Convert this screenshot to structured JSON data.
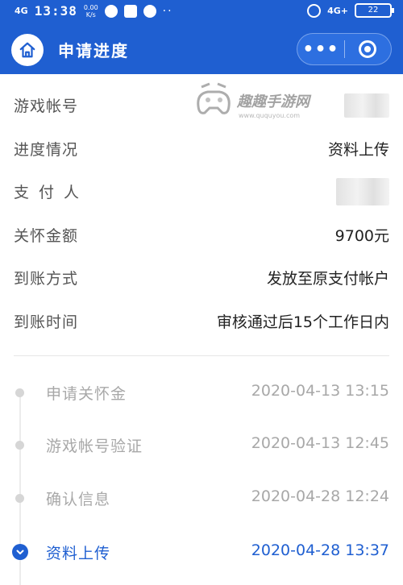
{
  "status_bar": {
    "network_left": "4G",
    "time": "13:38",
    "speed_value": "0.00",
    "speed_unit": "K/s",
    "dots": "··",
    "network_right": "4G+",
    "battery": "22"
  },
  "header": {
    "title": "申请进度",
    "more_label": "•••"
  },
  "info": {
    "rows": [
      {
        "label": "游戏帐号",
        "value": ""
      },
      {
        "label": "进度情况",
        "value": "资料上传"
      },
      {
        "label": "支付人",
        "value": ""
      },
      {
        "label": "关怀金额",
        "value": "9700元"
      },
      {
        "label": "到账方式",
        "value": "发放至原支付帐户"
      },
      {
        "label": "到账时间",
        "value": "审核通过后15个工作日内"
      }
    ]
  },
  "watermark": {
    "brand": "趣趣手游网",
    "url": "www.ququyou.com"
  },
  "timeline": {
    "steps": [
      {
        "name": "申请关怀金",
        "time": "2020-04-13 13:15",
        "active": false
      },
      {
        "name": "游戏帐号验证",
        "time": "2020-04-13 12:45",
        "active": false
      },
      {
        "name": "确认信息",
        "time": "2020-04-28 12:24",
        "active": false
      },
      {
        "name": "资料上传",
        "time": "2020-04-28 13:37",
        "active": true
      }
    ]
  },
  "colors": {
    "brand_blue": "#1f5fd1",
    "muted_text": "#a8a8a8"
  }
}
